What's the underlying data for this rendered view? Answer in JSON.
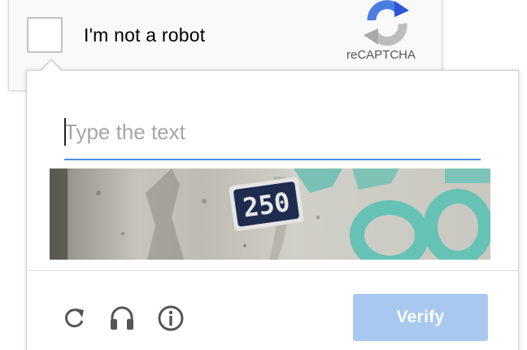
{
  "widget": {
    "label": "I'm not a robot",
    "brand": "reCAPTCHA",
    "logo_icon": "recaptcha-logo-icon",
    "checked": false
  },
  "challenge": {
    "input_placeholder": "Type the text",
    "input_value": "",
    "captcha_text": "250",
    "verify_label": "Verify",
    "icons": [
      "reload-icon",
      "headphones-icon",
      "info-icon"
    ]
  },
  "colors": {
    "accent": "#4a90e2",
    "verify_bg": "#a8c8f0",
    "placeholder": "#a6a6a6"
  }
}
